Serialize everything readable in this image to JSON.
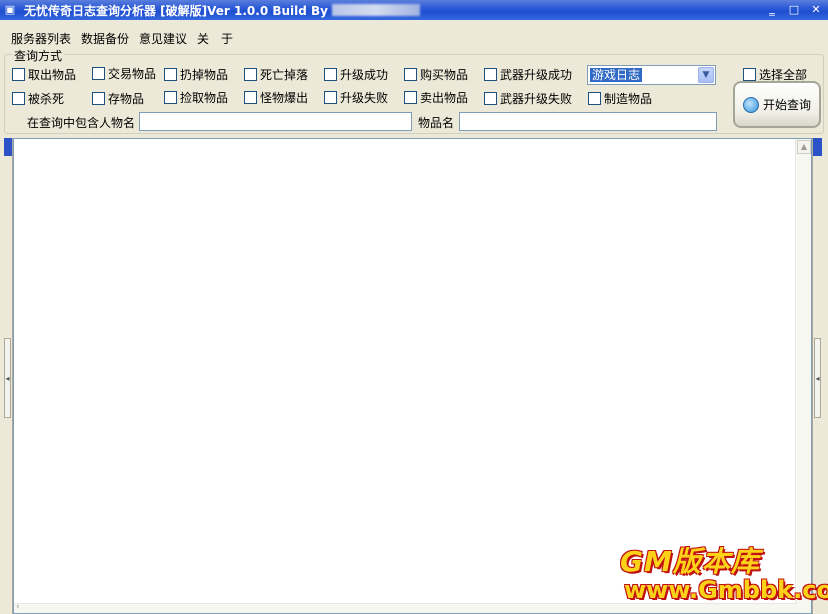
{
  "window": {
    "title": "无忧传奇日志查询分析器 [破解版]Ver 1.0.0 Build By",
    "app_icon": "app-icon",
    "controls": {
      "minimize": "‗",
      "maximize": "□",
      "close": "✕"
    }
  },
  "menu": [
    {
      "label": "服务器列表"
    },
    {
      "label": "数据备份"
    },
    {
      "label": "意见建议"
    },
    {
      "label": "关　于"
    }
  ],
  "query_group": {
    "legend": "查询方式",
    "row1": [
      "取出物品",
      "交易物品",
      "扔掉物品",
      "死亡掉落",
      "升级成功",
      "购买物品",
      "武器升级成功"
    ],
    "row2": [
      "被杀死",
      "存物品",
      "捡取物品",
      "怪物爆出",
      "升级失败",
      "卖出物品",
      "武器升级失败",
      "制造物品"
    ],
    "select_all": "选择全部",
    "log_type": "游戏日志",
    "query_button": "开始查询",
    "person_label": "在查询中包含人物名",
    "person_value": "",
    "item_label": "物品名",
    "item_value": ""
  },
  "watermark": {
    "line1": "版本库",
    "line1_prefix": "GM",
    "line2": "www.Gmbbk.com"
  },
  "colors": {
    "titlebar": "#2a5ad6",
    "selection": "#316ac5",
    "watermark_fill": "#ffd21a",
    "watermark_stroke": "#c01010"
  }
}
